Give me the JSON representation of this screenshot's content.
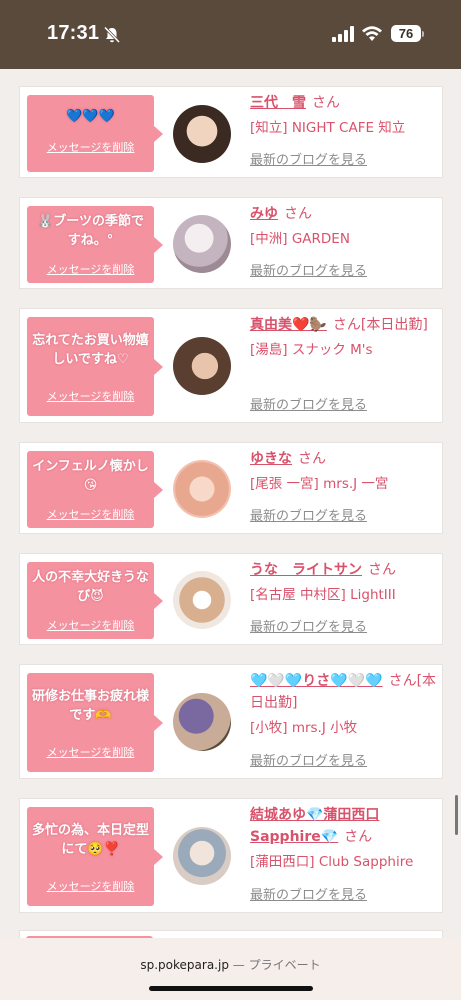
{
  "status": {
    "time": "17:31",
    "battery": "76"
  },
  "delete_label": "メッセージを削除",
  "blog_label": "最新のブログを見る",
  "san_label": "さん",
  "cards": [
    {
      "message": "💙💙💙",
      "name": "三代　雪",
      "name_suffix": "",
      "shop": "[知立] NIGHT CAFE 知立",
      "avatar_colors": [
        "#e8c8b0",
        "#3a2a22"
      ]
    },
    {
      "message": "🐰ブーツの季節ですね。°",
      "name": "みゆ",
      "name_suffix": "",
      "shop": "[中洲] GARDEN",
      "avatar_colors": [
        "#ddd3d8",
        "#b7a6b3"
      ]
    },
    {
      "message": "忘れてたお買い物嬉しいですね♡",
      "name": "真由美❤️🦫",
      "name_suffix": "[本日出勤]",
      "shop": "[湯島] スナック M's",
      "avatar_colors": [
        "#c9a48c",
        "#4a3228"
      ]
    },
    {
      "message": "インフェルノ懐かし😘",
      "name": "ゆきな",
      "name_suffix": "",
      "shop": "[尾張 一宮] mrs.J 一宮",
      "avatar_colors": [
        "#f4c4b4",
        "#d98870"
      ]
    },
    {
      "message": "人の不幸大好きうなび😈",
      "name": "うな　ライトサン",
      "name_suffix": "",
      "shop": "[名古屋 中村区] LightIII",
      "avatar_colors": [
        "#ece4dc",
        "#b89478"
      ]
    },
    {
      "message": "研修お仕事お疲れ様です🫶",
      "name": "🩵🤍🩵りさ🩵🤍🩵",
      "name_suffix": "[本日出勤]",
      "shop": "[小牧] mrs.J 小牧",
      "avatar_colors": [
        "#6a5a8a",
        "#c8b0a0"
      ]
    },
    {
      "message": "多忙の為、本日定型にて🥺❣️",
      "name": "結城あゆ💎蒲田西口Sapphire💎",
      "name_suffix": "",
      "shop": "[蒲田西口] Club Sapphire",
      "avatar_colors": [
        "#e0d4cc",
        "#8a9aa8"
      ]
    }
  ],
  "bottom": {
    "domain": "sp.pokepara.jp",
    "separator": " — ",
    "mode": "プライベート"
  }
}
